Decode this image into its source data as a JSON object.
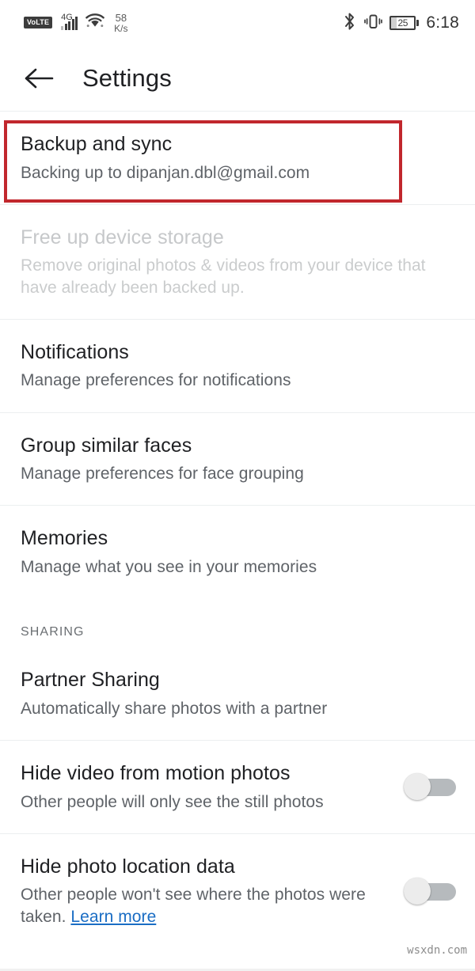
{
  "statusbar": {
    "volte": "VoLTE",
    "network_gen": "4G",
    "signal_icon": "signal-bars-icon",
    "wifi_icon": "wifi-icon",
    "speed_value": "58",
    "speed_unit": "K/s",
    "bluetooth_icon": "bluetooth-icon",
    "vibrate_icon": "vibrate-icon",
    "battery_percent": "25",
    "time": "6:18"
  },
  "appbar": {
    "back_icon": "back-arrow-icon",
    "title": "Settings"
  },
  "annotation": {
    "color": "#c1272d",
    "target": "backup-and-sync-row"
  },
  "list": [
    {
      "name": "backup-and-sync",
      "title": "Backup and sync",
      "subtitle": "Backing up to dipanjan.dbl@gmail.com"
    },
    {
      "name": "free-up-device-storage",
      "title": "Free up device storage",
      "subtitle": "Remove original photos & videos from your device that have already been backed up."
    },
    {
      "name": "notifications",
      "title": "Notifications",
      "subtitle": "Manage preferences for notifications"
    },
    {
      "name": "group-similar-faces",
      "title": "Group similar faces",
      "subtitle": "Manage preferences for face grouping"
    },
    {
      "name": "memories",
      "title": "Memories",
      "subtitle": "Manage what you see in your memories"
    }
  ],
  "sharing": {
    "header": "SHARING",
    "partner_sharing": {
      "title": "Partner Sharing",
      "subtitle": "Automatically share photos with a partner"
    },
    "hide_video": {
      "title": "Hide video from motion photos",
      "subtitle": "Other people will only see the still photos",
      "toggle_state": "off"
    },
    "hide_location": {
      "title": "Hide photo location data",
      "subtitle": "Other people won't see where the photos were taken. ",
      "link_text": "Learn more",
      "toggle_state": "off"
    }
  },
  "watermark": "wsxdn.com",
  "colors": {
    "accent_link": "#1a6dc4",
    "annotation_red": "#c1272d",
    "primary_text": "#202124",
    "secondary_text": "#5f6368",
    "disabled_text": "#c6c8ca"
  }
}
